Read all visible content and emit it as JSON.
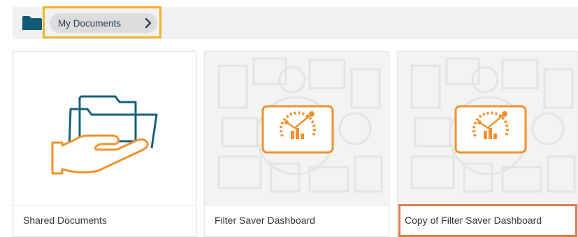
{
  "breadcrumb": {
    "home_icon": "folder-icon",
    "current": "My Documents",
    "separator_icon": "chevron-right-icon"
  },
  "colors": {
    "folder_blue": "#0f5a78",
    "highlight_yellow": "#f0b429",
    "selection_orange": "#e07b53",
    "dashboard_orange": "#f0922e"
  },
  "cards": [
    {
      "label": "Shared Documents",
      "icon": "shared-folder-hand-icon"
    },
    {
      "label": "Filter Saver Dashboard",
      "icon": "dashboard-thumbnail-icon"
    },
    {
      "label": "Copy of Filter Saver Dashboard",
      "icon": "dashboard-thumbnail-icon"
    }
  ]
}
